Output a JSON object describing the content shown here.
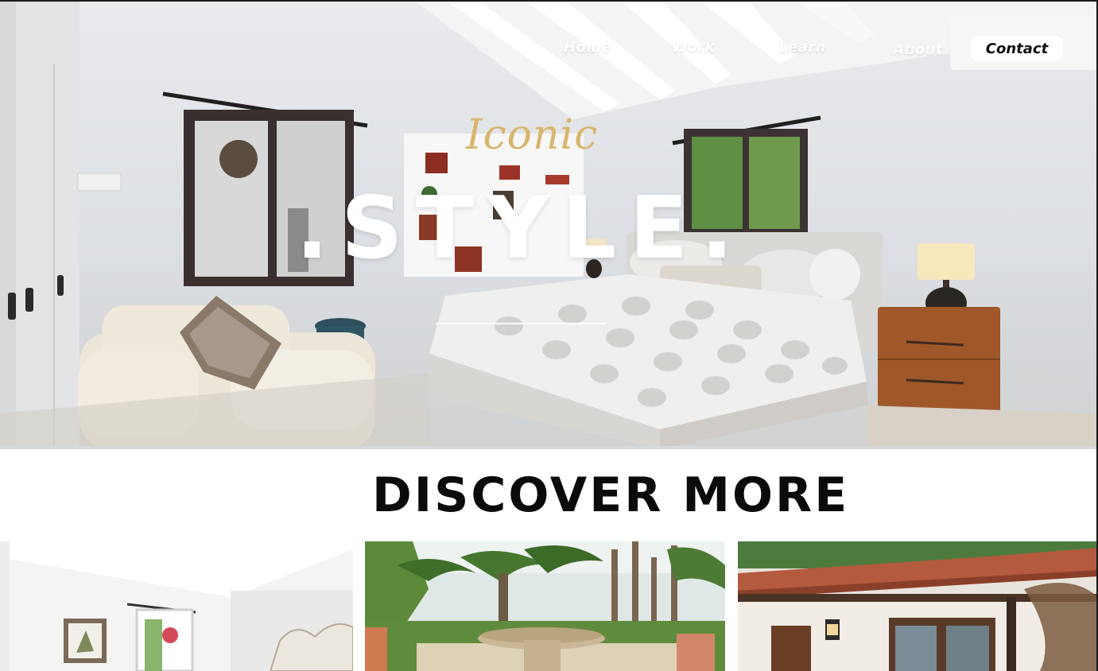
{
  "nav": {
    "home": "Home",
    "work": "Work",
    "learn": "Learn",
    "about": "About",
    "contact": "Contact"
  },
  "hero": {
    "script_word": "Iconic",
    "title": ".STYLE.",
    "image": "bedroom-photo"
  },
  "discover": {
    "title": "DISCOVER MORE",
    "cards": [
      {
        "image": "bedroom-interior-photo"
      },
      {
        "image": "garden-fountain-photo"
      },
      {
        "image": "house-exterior-photo"
      }
    ]
  },
  "colors": {
    "accent_gold": "#d9b56d",
    "contact_bg": "#ffffff",
    "heading": "#0b0b0b"
  }
}
